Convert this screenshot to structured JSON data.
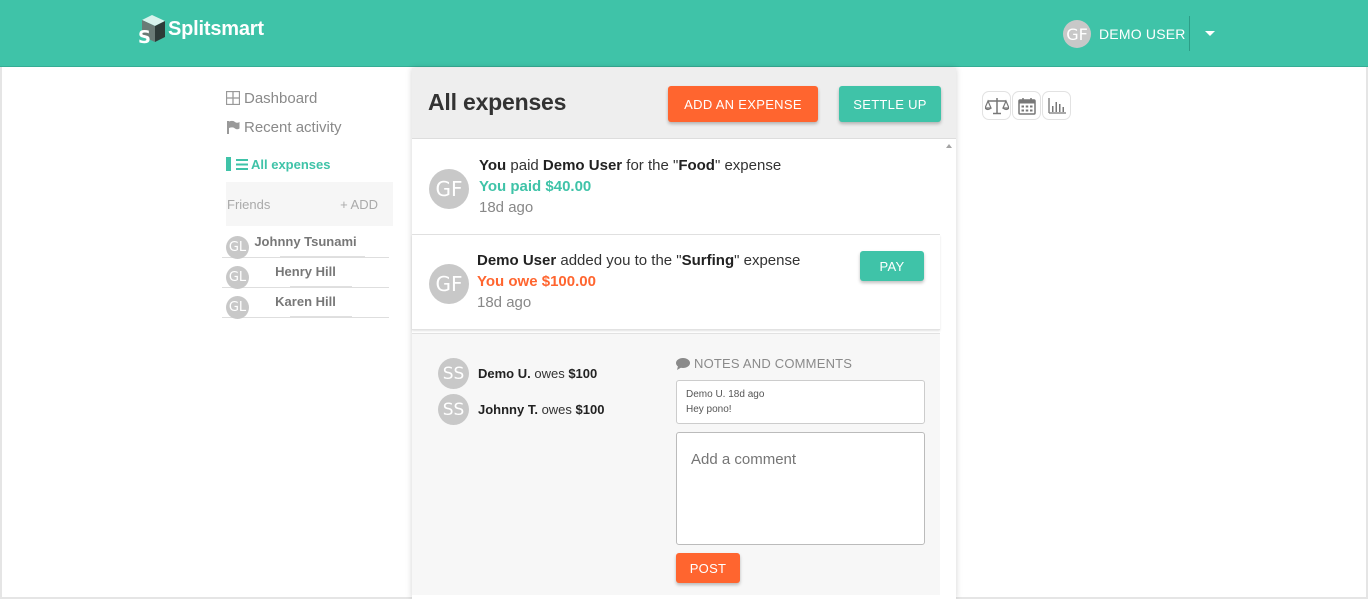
{
  "header": {
    "brand": "Splitsmart",
    "user_initials": "GF",
    "user_name": "DEMO USER"
  },
  "sidebar": {
    "nav": [
      {
        "label": "Dashboard",
        "icon": "grid-icon"
      },
      {
        "label": "Recent activity",
        "icon": "flag-icon"
      }
    ],
    "active": {
      "label": "All expenses",
      "icon": "list-icon"
    },
    "friends_label": "Friends",
    "add_label": "+ ADD",
    "friends": [
      {
        "initials": "GL",
        "name": "Johnny Tsunami"
      },
      {
        "initials": "GL",
        "name": "Henry Hill"
      },
      {
        "initials": "GL",
        "name": "Karen Hill"
      }
    ]
  },
  "main": {
    "title": "All expenses",
    "add_expense_label": "ADD AN EXPENSE",
    "settle_up_label": "SETTLE UP",
    "expenses": [
      {
        "initials": "GF",
        "actor": "You",
        "verb": " paid ",
        "target": "Demo User",
        "mid": " for the \"",
        "item": "Food",
        "end": "\" expense",
        "amount": "You paid $40.00",
        "ago": "18d ago"
      },
      {
        "initials": "GF",
        "actor": "Demo User",
        "verb": " added you to the \"",
        "item": "Surfing",
        "end": "\" expense",
        "amount": "You owe $100.00",
        "ago": "18d ago",
        "pay_label": "PAY"
      }
    ],
    "detail": {
      "owes": [
        {
          "initials": "SS",
          "name": "Demo U.",
          "text": " owes ",
          "amount": "$100"
        },
        {
          "initials": "SS",
          "name": "Johnny T.",
          "text": " owes ",
          "amount": "$100"
        }
      ],
      "notes_label": "NOTES AND COMMENTS",
      "note_meta": "Demo U. 18d ago",
      "note_text": "Hey pono!",
      "comment_placeholder": "Add a comment",
      "post_label": "POST"
    }
  },
  "tools": [
    "balance-scale-icon",
    "calendar-icon",
    "bar-chart-icon"
  ],
  "colors": {
    "brand": "#3fc3a8",
    "accent": "#ff652f",
    "avatar": "#c8c8c8"
  }
}
